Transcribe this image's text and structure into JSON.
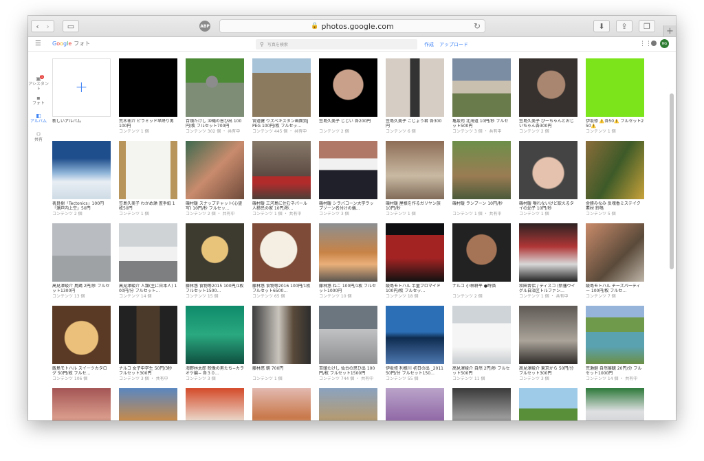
{
  "browser": {
    "url": "photos.google.com",
    "abp_label": "ABP"
  },
  "app": {
    "logo_letters": [
      "G",
      "o",
      "o",
      "g",
      "l",
      "e"
    ],
    "logo_suffix": "フォト",
    "search_placeholder": "写真を検索",
    "create_label": "作成",
    "upload_label": "アップロード",
    "avatar_label": "RG"
  },
  "nav": {
    "items": [
      {
        "label": "アシスタント",
        "badge": "1"
      },
      {
        "label": "フォト"
      },
      {
        "label": "アルバム"
      },
      {
        "label": "共有"
      }
    ]
  },
  "albums": {
    "new_album_label": "新しいアルバム",
    "rows": [
      [
        {
          "title": "荒木祐介 ピラミッド早降り男 100円",
          "meta": "コンテンツ 1 個"
        },
        {
          "title": "百頭たけし 沖縄の恩ひ出 100円/枚 フルセット700円",
          "meta": "コンテンツ 302 個 ・ 共有中"
        },
        {
          "title": "宮道健 ウズベキスタン画面質JPEG 100円/枚 フルセッ…",
          "meta": "コンテンツ 445 個 ・ 共有中"
        },
        {
          "title": "笠島久美子 じじい 各200円",
          "meta": "コンテンツ 2 個"
        },
        {
          "title": "笠島久美子 こじょう君 各300円",
          "meta": "コンテンツ 6 個"
        },
        {
          "title": "亀坂司 北海道 10円/秒 フルセット500円",
          "meta": "コンテンツ 3 個 ・ 共有中"
        },
        {
          "title": "笠島久美子 ぴーちゃんとおじいちゃん各300円",
          "meta": "コンテンツ 2 個"
        },
        {
          "title": "伊坂修 ⚠️各50⚠️ フルセット250⚠️",
          "meta": "コンテンツ 1 個"
        }
      ],
      [
        {
          "title": "表良樹「Tectonics」100円「瀬戸内上空」50円",
          "meta": "コンテンツ 2 個"
        },
        {
          "title": "笠島久美子 わかめ瀬 置手紙 1枚50円",
          "meta": "コンテンツ 1 個"
        },
        {
          "title": "磯村暖 スナップチャット(心霊写) 10円/秒 フルセッ…",
          "meta": "コンテンツ 2 個 ・ 共有中"
        },
        {
          "title": "磯村暖 三河島に住むネパール人移民の家 10円/秒…",
          "meta": "コンテンツ 1 個 ・ 共有中"
        },
        {
          "title": "磯村暖 シラバコーン大学ラップソーン名付けの儀…",
          "meta": "コンテンツ 3 個"
        },
        {
          "title": "磯村暖 屋根を作るガリヤン族 10円/秒",
          "meta": "コンテンツ 1 個"
        },
        {
          "title": "磯村暖 ランブーン 10円/秒",
          "meta": "コンテンツ 1 個 ・ 共有中"
        },
        {
          "title": "磯村暖 喉れないけど飲えるタイの幼子 10円/秒",
          "meta": "コンテンツ 1 個"
        },
        {
          "title": "金勝みなみ 反魂香ミステイク素材 鈴鳴",
          "meta": "コンテンツ 5 個"
        }
      ],
      [
        {
          "title": "高見澤峻介 鳥鶏 2円/秒 フルセット1300円",
          "meta": "コンテンツ 13 個"
        },
        {
          "title": "高見澤峻介 人類(主に日本人) 100円/分 フルセット…",
          "meta": "コンテンツ 14 個"
        },
        {
          "title": "藤林悠 食物等2015 100円/1枚 フルセット1500…",
          "meta": "コンテンツ 15 個"
        },
        {
          "title": "藤林悠 食物等2016 100円/1枚 フルセット6500…",
          "meta": "コンテンツ 65 個"
        },
        {
          "title": "藤林悠 ねこ 100円/1枚 フルセット1000円",
          "meta": "コンテンツ 10 個"
        },
        {
          "title": "飯島モトハル 半量ブロマイド 100円/枚 フルセッ…",
          "meta": "コンテンツ 18 個"
        },
        {
          "title": "ナルコ 小林耕平 ●時価",
          "meta": "コンテンツ 2 個"
        },
        {
          "title": "和田晋侶 / ディスコ (新藩ウイグル自治区トルファン…",
          "meta": "コンテンツ 1 個 ・ 共有中"
        },
        {
          "title": "飯島モトハル チーズパーティー 100円/枚 フルセ…",
          "meta": "コンテンツ 7 個"
        }
      ],
      [
        {
          "title": "飯島モトハル スイーツカタログ 50円/枚 フルセ…",
          "meta": "コンテンツ 106 個"
        },
        {
          "title": "ナルコ 女子中学生 50円/3秒 フルセット300円",
          "meta": "コンテンツ 3 個 ・ 共有中"
        },
        {
          "title": "海野林太郎 映像の男たち−カラオケ編− 各３０…",
          "meta": "コンテンツ 3 個"
        },
        {
          "title": "藤林悠 朝 700円",
          "meta": "コンテンツ 1 個"
        },
        {
          "title": "百頭たけし 仙台の思ひ出 100円/枚 フルセット1500円",
          "meta": "コンテンツ 744 個 ・ 共有中"
        },
        {
          "title": "伊坂修 利根川 初日の出 _2011 50円/分 フルセット150…",
          "meta": "コンテンツ 55 個"
        },
        {
          "title": "高見澤峻介 自然 2円/秒 フルセット500円",
          "meta": "コンテンツ 11 個"
        },
        {
          "title": "高見澤峻介 東京から 50円/分 フルセット300円",
          "meta": "コンテンツ 3 個"
        },
        {
          "title": "荒瀬継 自然展観 20円/分 フルセット1000円",
          "meta": "コンテンツ 14 個 ・ 共有中"
        }
      ]
    ]
  }
}
